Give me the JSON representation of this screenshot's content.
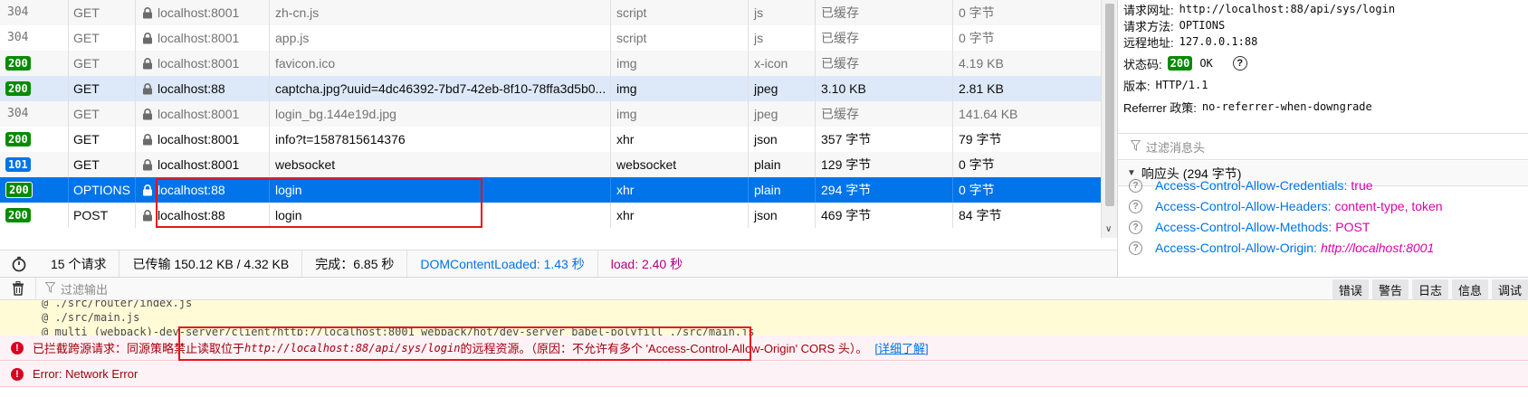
{
  "network": {
    "rows": [
      {
        "status": "304",
        "status_kind": "plain",
        "method": "GET",
        "secure": true,
        "domain": "localhost:8001",
        "file": "zh-cn.js",
        "cause": "script",
        "type": "js",
        "transferred": "已缓存",
        "size": "0 字节",
        "state": "cached odd"
      },
      {
        "status": "304",
        "status_kind": "plain",
        "method": "GET",
        "secure": true,
        "domain": "localhost:8001",
        "file": "app.js",
        "cause": "script",
        "type": "js",
        "transferred": "已缓存",
        "size": "0 字节",
        "state": "cached"
      },
      {
        "status": "200",
        "status_kind": "ok",
        "method": "GET",
        "secure": true,
        "domain": "localhost:8001",
        "file": "favicon.ico",
        "cause": "img",
        "type": "x-icon",
        "transferred": "已缓存",
        "size": "4.19 KB",
        "state": "cached odd"
      },
      {
        "status": "200",
        "status_kind": "ok",
        "method": "GET",
        "secure": true,
        "domain": "localhost:88",
        "file": "captcha.jpg?uuid=4dc46392-7bd7-42eb-8f10-78ffa3d5b0...",
        "cause": "img",
        "type": "jpeg",
        "transferred": "3.10 KB",
        "size": "2.81 KB",
        "state": "highlight"
      },
      {
        "status": "304",
        "status_kind": "plain",
        "method": "GET",
        "secure": true,
        "domain": "localhost:8001",
        "file": "login_bg.144e19d.jpg",
        "cause": "img",
        "type": "jpeg",
        "transferred": "已缓存",
        "size": "141.64 KB",
        "state": "cached odd"
      },
      {
        "status": "200",
        "status_kind": "ok",
        "method": "GET",
        "secure": true,
        "domain": "localhost:8001",
        "file": "info?t=1587815614376",
        "cause": "xhr",
        "type": "json",
        "transferred": "357 字节",
        "size": "79 字节",
        "state": ""
      },
      {
        "status": "101",
        "status_kind": "info",
        "method": "GET",
        "secure": true,
        "domain": "localhost:8001",
        "file": "websocket",
        "cause": "websocket",
        "type": "plain",
        "transferred": "129 字节",
        "size": "0 字节",
        "state": "odd"
      },
      {
        "status": "200",
        "status_kind": "ok",
        "method": "OPTIONS",
        "secure": true,
        "domain": "localhost:88",
        "file": "login",
        "cause": "xhr",
        "type": "plain",
        "transferred": "294 字节",
        "size": "0 字节",
        "state": "selected"
      },
      {
        "status": "200",
        "status_kind": "ok",
        "method": "POST",
        "secure": true,
        "domain": "localhost:88",
        "file": "login",
        "cause": "xhr",
        "type": "json",
        "transferred": "469 字节",
        "size": "84 字节",
        "state": ""
      }
    ],
    "scroll_arrow": "∨"
  },
  "summary": {
    "requests": "15 个请求",
    "transferred": "已传输 150.12 KB / 4.32 KB",
    "finish": "完成：6.85 秒",
    "dom_loaded": "DOMContentLoaded: 1.43 秒",
    "load": "load: 2.40 秒"
  },
  "details": {
    "url_key": "请求网址:",
    "url_val": "http://localhost:88/api/sys/login",
    "method_key": "请求方法:",
    "method_val": "OPTIONS",
    "remote_key": "远程地址:",
    "remote_val": "127.0.0.1:88",
    "status_key": "状态码:",
    "status_code": "200",
    "status_text": "OK",
    "version_key": "版本:",
    "version_val": "HTTP/1.1",
    "referrer_key": "Referrer 政策:",
    "referrer_val": "no-referrer-when-downgrade",
    "filter_placeholder": "过滤消息头",
    "response_section": "响应头 (294 字节)",
    "headers": [
      {
        "name": "Access-Control-Allow-Credentials:",
        "value": "true",
        "italic": false
      },
      {
        "name": "Access-Control-Allow-Headers:",
        "value": "content-type, token",
        "italic": false
      },
      {
        "name": "Access-Control-Allow-Methods:",
        "value": "POST",
        "italic": false
      },
      {
        "name": "Access-Control-Allow-Origin:",
        "value": "http://localhost:8001",
        "italic": true
      }
    ]
  },
  "console": {
    "filter_placeholder": "过滤输出",
    "levels": [
      "错误",
      "警告",
      "日志",
      "信息",
      "调试"
    ],
    "warn_lines": [
      "@ ./src/router/index.js",
      "@ ./src/main.js",
      "@ multi (webpack)-dev-server/client?http://localhost:8001 webpack/hot/dev-server babel-polyfill ./src/main.js"
    ],
    "error_prefix": "已拦截跨源请求：同源策略禁止读取位于 ",
    "error_url": "http://localhost:88/api/sys/login",
    "error_suffix": " 的远程资源。（原因：不允许有多个 'Access-Control-Allow-Origin' CORS 头）。",
    "error_learn": "[详细了解]",
    "error2": "Error: Network Error"
  }
}
